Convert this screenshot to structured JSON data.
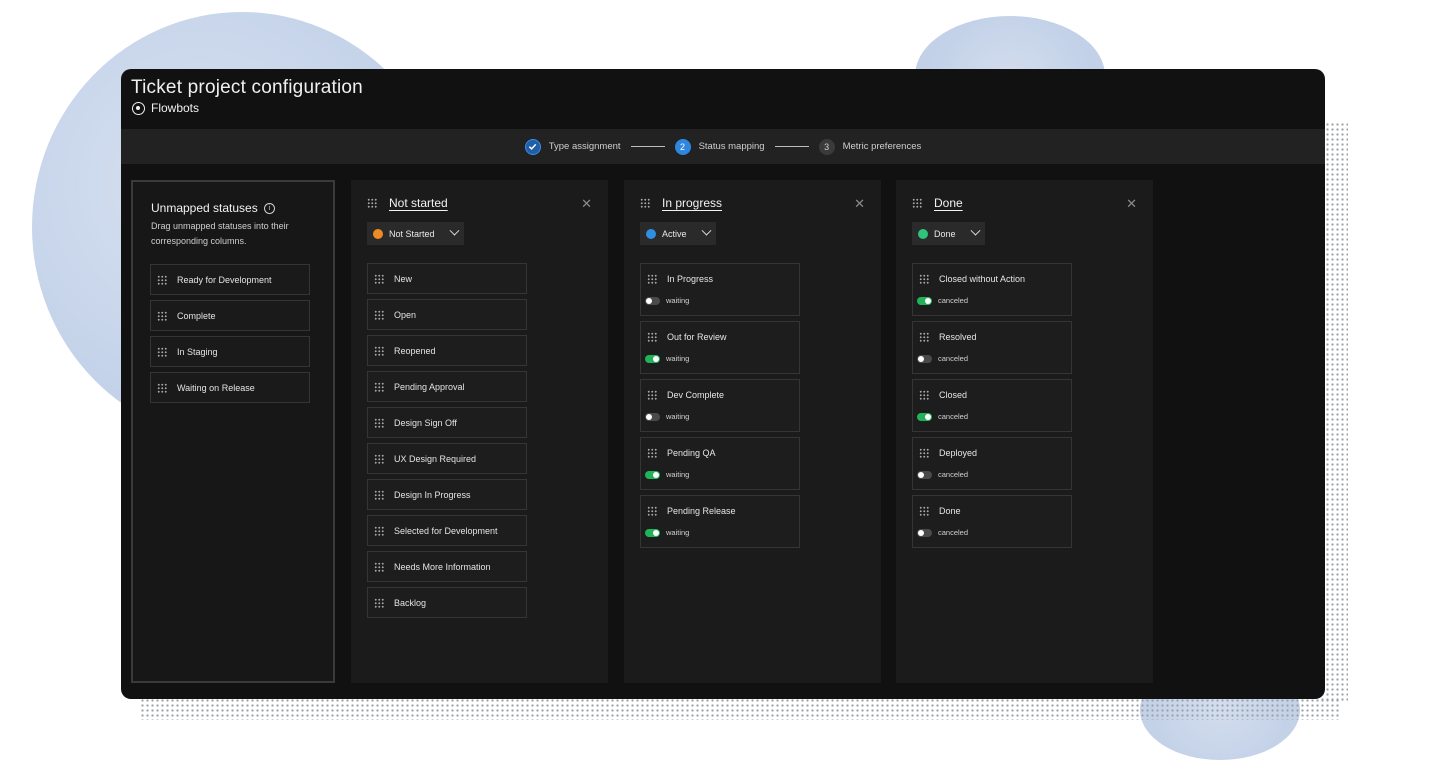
{
  "window": {
    "title": "Ticket project configuration",
    "brand": "Flowbots"
  },
  "stepper": {
    "steps": [
      {
        "number": "",
        "label": "Type assignment",
        "state": "done"
      },
      {
        "number": "2",
        "label": "Status mapping",
        "state": "active"
      },
      {
        "number": "3",
        "label": "Metric preferences",
        "state": "todo"
      }
    ]
  },
  "unmapped": {
    "title": "Unmapped statuses",
    "info_icon": "i",
    "description": "Drag unmapped statuses into their corresponding columns.",
    "items": [
      "Ready for Development",
      "Complete",
      "In Staging",
      "Waiting on Release"
    ]
  },
  "columns": [
    {
      "title": "Not started",
      "close": "✕",
      "select": {
        "value": "Not Started",
        "color": "#f08a24"
      },
      "items": [
        "New",
        "Open",
        "Reopened",
        "Pending Approval",
        "Design Sign Off",
        "UX Design Required",
        "Design In Progress",
        "Selected for Development",
        "Needs More Information",
        "Backlog"
      ]
    },
    {
      "title": "In progress",
      "close": "✕",
      "select": {
        "value": "Active",
        "color": "#2f8fe0"
      },
      "cards": [
        {
          "label": "In Progress",
          "toggle_label": "waiting",
          "toggle_on": false
        },
        {
          "label": "Out for Review",
          "toggle_label": "waiting",
          "toggle_on": true
        },
        {
          "label": "Dev Complete",
          "toggle_label": "waiting",
          "toggle_on": false
        },
        {
          "label": "Pending QA",
          "toggle_label": "waiting",
          "toggle_on": true
        },
        {
          "label": "Pending Release",
          "toggle_label": "waiting",
          "toggle_on": true
        }
      ]
    },
    {
      "title": "Done",
      "close": "✕",
      "select": {
        "value": "Done",
        "color": "#2ec27a"
      },
      "cards": [
        {
          "label": "Closed without Action",
          "toggle_label": "canceled",
          "toggle_on": true
        },
        {
          "label": "Resolved",
          "toggle_label": "canceled",
          "toggle_on": false
        },
        {
          "label": "Closed",
          "toggle_label": "canceled",
          "toggle_on": true
        },
        {
          "label": "Deployed",
          "toggle_label": "canceled",
          "toggle_on": false
        },
        {
          "label": "Done",
          "toggle_label": "canceled",
          "toggle_on": false
        }
      ]
    }
  ],
  "colors": {
    "window_bg": "#111111",
    "panel_bg": "#1b1b1b",
    "toggle_on": "#22b35a",
    "step_active": "#2f86df"
  }
}
